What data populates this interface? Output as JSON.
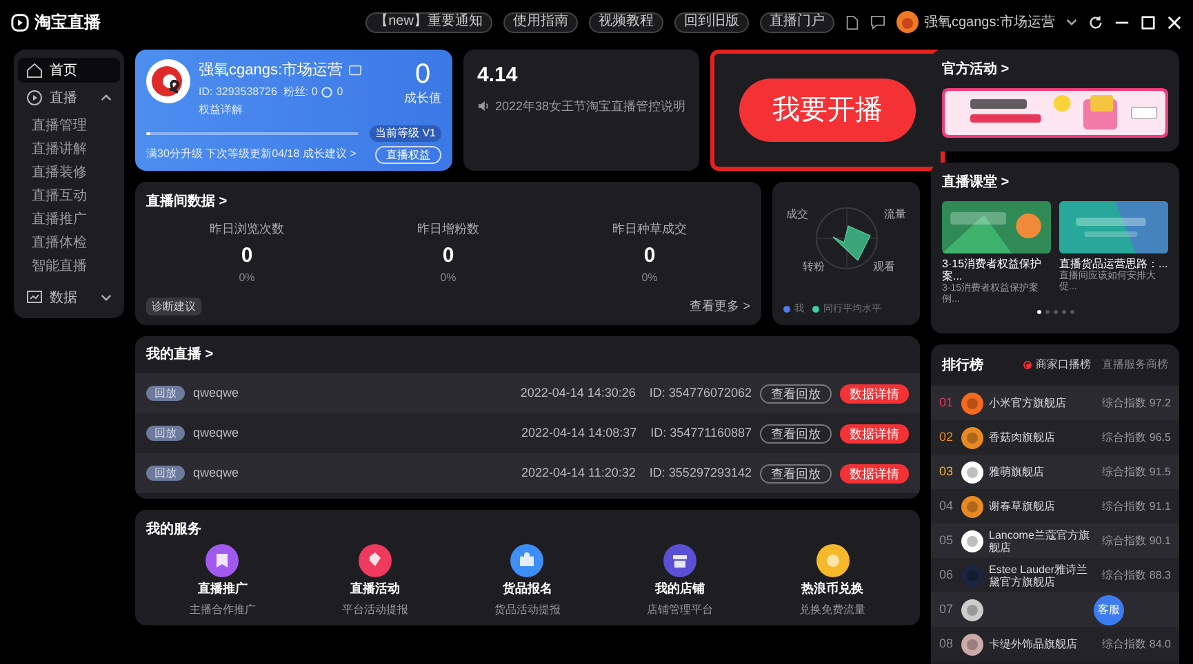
{
  "app": {
    "logo_text": "淘宝直播"
  },
  "top_bar": {
    "buttons": [
      "【new】重要通知",
      "使用指南",
      "视频教程",
      "回到旧版",
      "直播门户"
    ],
    "user_name": "强氧cgangs:市场运营"
  },
  "sidebar": {
    "items": [
      {
        "label": "首页",
        "selected": true
      },
      {
        "label": "直播",
        "selected": false,
        "expanded": true,
        "children": [
          {
            "label": "直播管理",
            "selected": false
          },
          {
            "label": "直播讲解",
            "selected": false
          },
          {
            "label": "直播装修",
            "selected": false
          },
          {
            "label": "直播互动",
            "selected": false
          },
          {
            "label": "直播推广",
            "selected": false
          },
          {
            "label": "直播体检",
            "selected": false
          },
          {
            "label": "智能直播",
            "selected": false
          }
        ]
      },
      {
        "label": "数据",
        "selected": false,
        "expanded": false
      }
    ]
  },
  "profile": {
    "name": "强氧cgangs:市场运营",
    "id_line": "ID: 3293538726  粉丝: 0",
    "coins": "0",
    "rights": "权益详解",
    "growth_value": "0",
    "growth_label": "成长值",
    "level": 0.02,
    "level_badge": "当前等级 V1",
    "rights_button": "直播权益",
    "upgrade_text": "满30分升级 下次等级更新04/18 成长建议 >"
  },
  "notice": {
    "date": "4.14",
    "text": "2022年38女王节淘宝直播管控说明"
  },
  "go_live": {
    "label": "我要开播"
  },
  "live_data": {
    "title": "直播间数据 >",
    "metrics": [
      {
        "label": "昨日浏览次数",
        "value": "0",
        "change": "0%"
      },
      {
        "label": "昨日增粉数",
        "value": "0",
        "change": "0%"
      },
      {
        "label": "昨日种草成交",
        "value": "0",
        "change": "0%"
      }
    ],
    "tag": "诊断建议",
    "more": "查看更多 >"
  },
  "radar": {
    "axes": [
      "成交",
      "流量",
      "转粉",
      "观看"
    ],
    "legend": [
      {
        "label": "我",
        "color": "#4a7cf0"
      },
      {
        "label": "同行平均水平",
        "color": "#3ecf9a"
      }
    ]
  },
  "my_live": {
    "title": "我的直播 >",
    "rows": [
      {
        "tag": "回放",
        "name": "qweqwe",
        "time": "2022-04-14 14:30:26",
        "id": "ID: 354776072062",
        "replay": "查看回放",
        "details": "数据详情"
      },
      {
        "tag": "回放",
        "name": "qweqwe",
        "time": "2022-04-14 14:08:37",
        "id": "ID: 354771160887",
        "replay": "查看回放",
        "details": "数据详情"
      },
      {
        "tag": "回放",
        "name": "qweqwe",
        "time": "2022-04-14 11:20:32",
        "id": "ID: 355297293142",
        "replay": "查看回放",
        "details": "数据详情"
      }
    ]
  },
  "services": {
    "title": "我的服务",
    "items": [
      {
        "title": "直播推广",
        "subtitle": "主播合作推广",
        "color": "#a259f0"
      },
      {
        "title": "直播活动",
        "subtitle": "平台活动提报",
        "color": "#f0395e"
      },
      {
        "title": "货品报名",
        "subtitle": "货品活动提报",
        "color": "#3d8ef5"
      },
      {
        "title": "我的店铺",
        "subtitle": "店铺管理平台",
        "color": "#5b4fd6"
      },
      {
        "title": "热浪币兑换",
        "subtitle": "兑换免费流量",
        "color": "#f5b82a"
      }
    ]
  },
  "official_activity": {
    "title": "官方活动 >"
  },
  "live_class": {
    "title": "直播课堂 >",
    "cards": [
      {
        "title": "3·15消费者权益保护案...",
        "subtitle": "3·15消费者权益保护案例..."
      },
      {
        "title": "直播货品运营思路：...",
        "subtitle": "直播间应该如何安排大促..."
      }
    ],
    "dots": [
      {
        "selected": true
      },
      {
        "selected": false
      },
      {
        "selected": false
      },
      {
        "selected": false
      },
      {
        "selected": false
      }
    ]
  },
  "ranking": {
    "title": "排行榜",
    "tabs": [
      {
        "label": "商家口播榜",
        "selected": true
      },
      {
        "label": "直播服务商榜",
        "selected": false
      }
    ],
    "rows": [
      {
        "rank": "01",
        "color": "#e8385a",
        "name": "小米官方旗舰店",
        "score": "综合指数 97.2"
      },
      {
        "rank": "02",
        "color": "#f08a24",
        "name": "香菇肉旗舰店",
        "score": "综合指数 96.5"
      },
      {
        "rank": "03",
        "color": "#f0b429",
        "name": "雅萌旗舰店",
        "score": "综合指数 91.5"
      },
      {
        "rank": "04",
        "color": "#8a8a92",
        "name": "谢春草旗舰店",
        "score": "综合指数 91.1"
      },
      {
        "rank": "05",
        "color": "#8a8a92",
        "name": "Lancome兰蔻官方旗舰店",
        "score": "综合指数 90.1"
      },
      {
        "rank": "06",
        "color": "#8a8a92",
        "name": "Estee Lauder雅诗兰黛官方旗舰店",
        "score": "综合指数 88.3"
      },
      {
        "rank": "07",
        "color": "#8a8a92"
      },
      {
        "rank": "08",
        "color": "#8a8a92",
        "name": "卡缇外饰品旗舰店",
        "score": "综合指数 84.0"
      }
    ]
  },
  "support": {
    "label": "客服"
  }
}
